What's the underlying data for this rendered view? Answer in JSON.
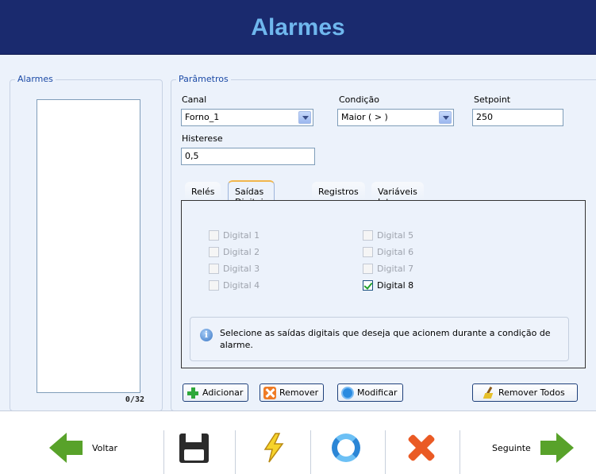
{
  "header": {
    "title": "Alarmes"
  },
  "alarms_panel": {
    "legend": "Alarmes",
    "count": "0/32"
  },
  "params_panel": {
    "legend": "Parâmetros",
    "canal": {
      "label": "Canal",
      "value": "Forno_1"
    },
    "condicao": {
      "label": "Condição",
      "value": "Maior ( > )"
    },
    "setpoint": {
      "label": "Setpoint",
      "value": "250"
    },
    "histerese": {
      "label": "Histerese",
      "value": "0,5"
    }
  },
  "tabs": [
    {
      "label": "Relés",
      "active": false
    },
    {
      "label": "Saídas Digitais",
      "active": true
    },
    {
      "label": "Registros",
      "active": false
    },
    {
      "label": "Variáveis Internas",
      "active": false
    }
  ],
  "digital_outputs": [
    {
      "label": "Digital 1",
      "checked": false
    },
    {
      "label": "Digital 2",
      "checked": false
    },
    {
      "label": "Digital 3",
      "checked": false
    },
    {
      "label": "Digital 4",
      "checked": false
    },
    {
      "label": "Digital 5",
      "checked": false
    },
    {
      "label": "Digital 6",
      "checked": false
    },
    {
      "label": "Digital 7",
      "checked": false
    },
    {
      "label": "Digital 8",
      "checked": true
    }
  ],
  "info": {
    "text": "Selecione as saídas digitais que deseja que acionem durante a condição de alarme."
  },
  "actions": {
    "add": "Adicionar",
    "remove": "Remover",
    "modify": "Modificar",
    "remove_all": "Remover Todos"
  },
  "footer": {
    "back": "Voltar",
    "next": "Seguinte",
    "icons": [
      "save-icon",
      "lightning-icon",
      "refresh-icon",
      "close-icon"
    ]
  },
  "colors": {
    "header_bg": "#1a2a6e",
    "title": "#6fb7ee",
    "accent_green": "#58a22a",
    "accent_orange": "#ea5a24"
  }
}
